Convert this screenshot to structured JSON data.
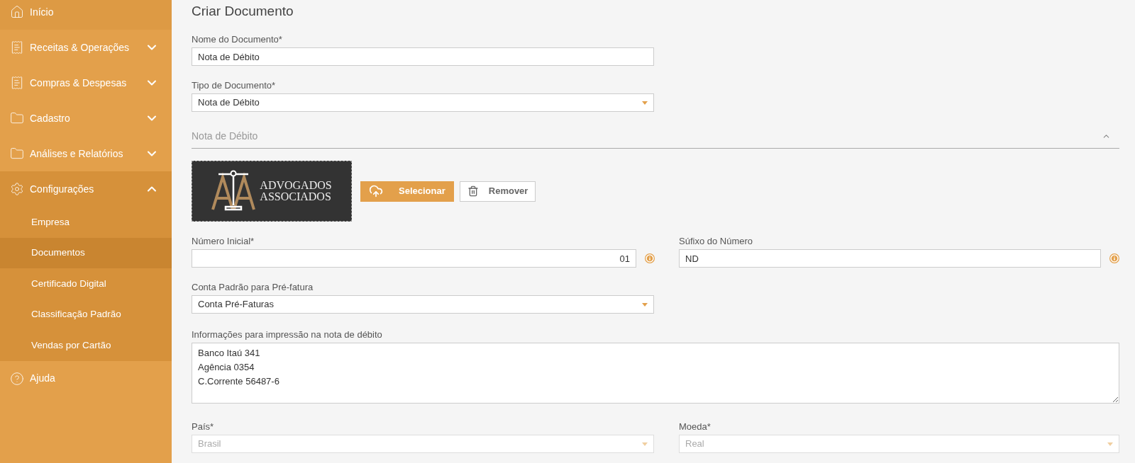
{
  "sidebar": {
    "items": [
      {
        "label": "Início",
        "kind": "link"
      },
      {
        "label": "Receitas & Operações",
        "kind": "group",
        "expanded": false
      },
      {
        "label": "Compras & Despesas",
        "kind": "group",
        "expanded": false
      },
      {
        "label": "Cadastro",
        "kind": "group",
        "expanded": false
      },
      {
        "label": "Análises e Relatórios",
        "kind": "group",
        "expanded": false
      },
      {
        "label": "Configurações",
        "kind": "group",
        "expanded": true,
        "children": [
          {
            "label": "Empresa",
            "selected": false
          },
          {
            "label": "Documentos",
            "selected": true
          },
          {
            "label": "Certificado Digital",
            "selected": false
          },
          {
            "label": "Classificação Padrão",
            "selected": false
          },
          {
            "label": "Vendas por Cartão",
            "selected": false
          }
        ]
      },
      {
        "label": "Ajuda",
        "kind": "link"
      }
    ]
  },
  "page": {
    "title": "Criar Documento",
    "name_field": {
      "label": "Nome do Documento*",
      "value": "Nota de Débito"
    },
    "type_field": {
      "label": "Tipo de Documento*",
      "value": "Nota de Débito"
    },
    "section": {
      "title": "Nota de Débito",
      "expanded": true,
      "logo": {
        "lines": [
          "ADVOGADOS",
          "ASSOCIADOS"
        ]
      },
      "buttons": [
        {
          "kind": "upload",
          "label": "Selecionar"
        },
        {
          "kind": "remove",
          "label": "Remover"
        }
      ],
      "number_field": {
        "label": "Número Inicial*",
        "value": "01"
      },
      "suffix_field": {
        "label": "Súfixo do Número",
        "value": "ND"
      },
      "account_field": {
        "label": "Conta Padrão para Pré-fatura",
        "value": "Conta Pré-Faturas"
      },
      "info_field": {
        "label": "Informações para impressão na nota de débito",
        "value": "Banco Itaú 341\nAgência 0354\nC.Corrente 56487-6"
      },
      "country_field": {
        "label": "País*",
        "value": "Brasil",
        "disabled": true
      },
      "currency_field": {
        "label": "Moeda*",
        "value": "Real",
        "disabled": true
      }
    }
  }
}
